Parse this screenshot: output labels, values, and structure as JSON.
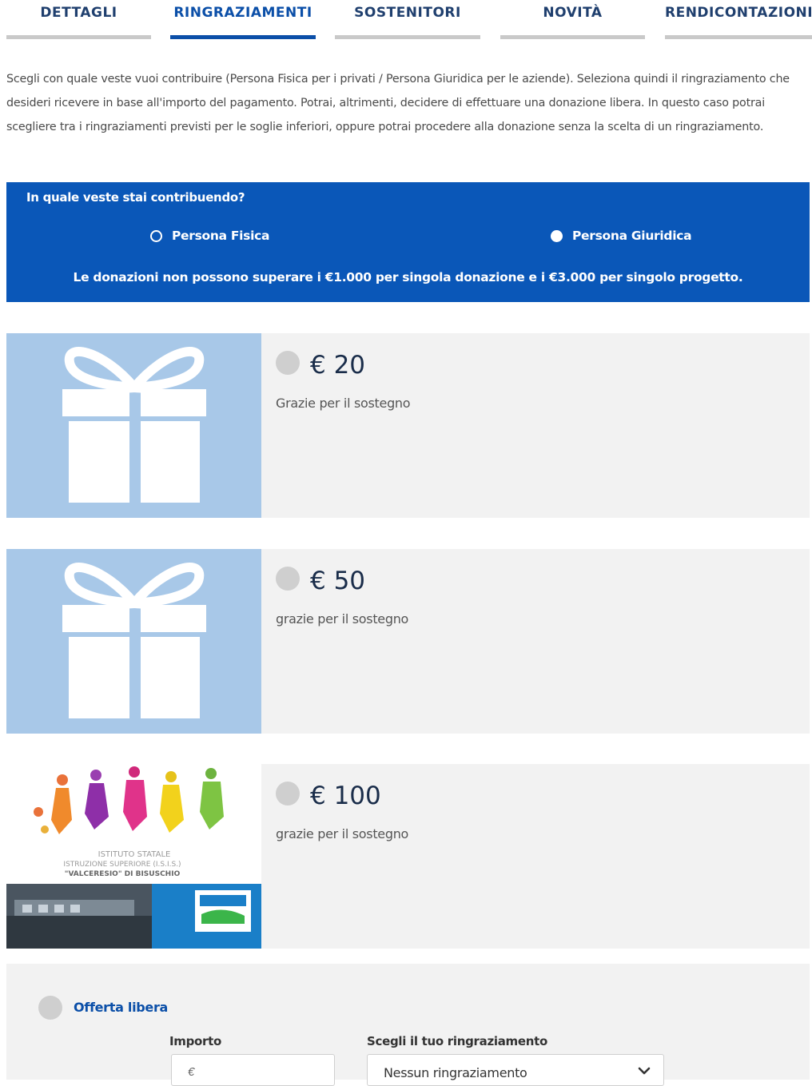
{
  "tabs": [
    {
      "label": "DETTAGLI",
      "active": false
    },
    {
      "label": "RINGRAZIAMENTI",
      "active": true
    },
    {
      "label": "SOSTENITORI",
      "active": false
    },
    {
      "label": "NOVITÀ",
      "active": false
    },
    {
      "label": "RENDICONTAZIONI",
      "active": false
    }
  ],
  "intro": "Scegli con quale veste vuoi contribuire (Persona Fisica per i privati / Persona Giuridica per le aziende). Seleziona quindi il ringraziamento che desideri ricevere in base all'importo del pagamento. Potrai, altrimenti, decidere di effettuare una donazione libera. In questo caso potrai scegliere tra i ringraziamenti previsti per le soglie inferiori, oppure potrai procedere alla donazione senza la scelta di un ringraziamento.",
  "contributor": {
    "question": "In quale veste stai contribuendo?",
    "option_fisica": "Persona Fisica",
    "option_giuridica": "Persona Giuridica",
    "selected": "Persona Fisica",
    "note": "Le donazioni non possono superare i €1.000 per singola donazione e i €3.000 per singolo progetto."
  },
  "rewards": [
    {
      "amount": "€ 20",
      "description": "Grazie per il sostegno",
      "image": "gift-icon"
    },
    {
      "amount": "€ 50",
      "description": "grazie per il sostegno",
      "image": "gift-icon"
    },
    {
      "amount": "€ 100",
      "description": "grazie per il sostegno",
      "image": "school-logo",
      "logo_text": [
        "ISTITUTO STATALE",
        "ISTRUZIONE SUPERIORE (I.S.I.S.)",
        "\"VALCERESIO\" DI BISUSCHIO"
      ]
    }
  ],
  "free_offer": {
    "title": "Offerta libera",
    "amount_label": "Importo",
    "amount_placeholder": "€",
    "reward_label": "Scegli il tuo ringraziamento",
    "reward_value": "Nessun ringraziamento"
  },
  "colors": {
    "brand_blue": "#0a57b8",
    "card_bg": "#f2f2f2",
    "image_bg": "#a8c8e8"
  }
}
